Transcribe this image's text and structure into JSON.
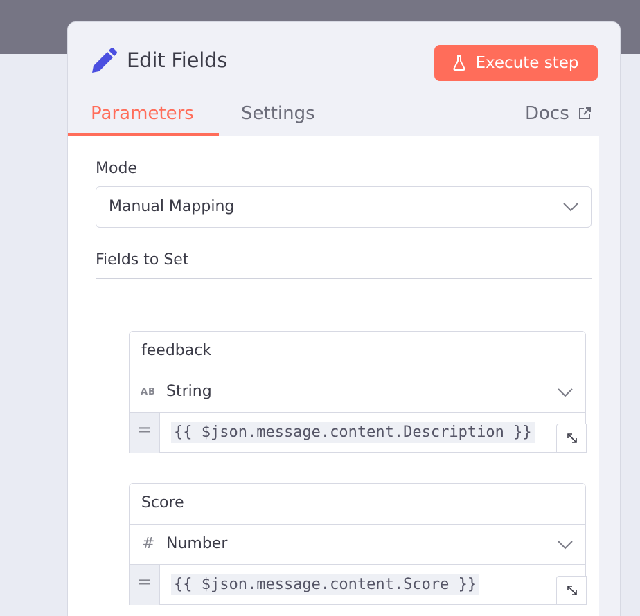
{
  "panel": {
    "title": "Edit Fields",
    "execute_label": "Execute step"
  },
  "tabs": [
    {
      "label": "Parameters",
      "active": true
    },
    {
      "label": "Settings",
      "active": false
    }
  ],
  "docs_label": "Docs",
  "mode": {
    "label": "Mode",
    "value": "Manual Mapping"
  },
  "fields_section": {
    "label": "Fields to Set",
    "fields": [
      {
        "name": "feedback",
        "type_icon": "AB",
        "type": "String",
        "value": "{{ $json.message.content.Description }}"
      },
      {
        "name": "Score",
        "type_icon": "#",
        "type": "Number",
        "value": "{{ $json.message.content.Score }}"
      }
    ]
  },
  "colors": {
    "accent": "#ff6d5a",
    "text": "#3b3b47",
    "muted": "#6b6c79",
    "pencil": "#4b4fe0"
  }
}
